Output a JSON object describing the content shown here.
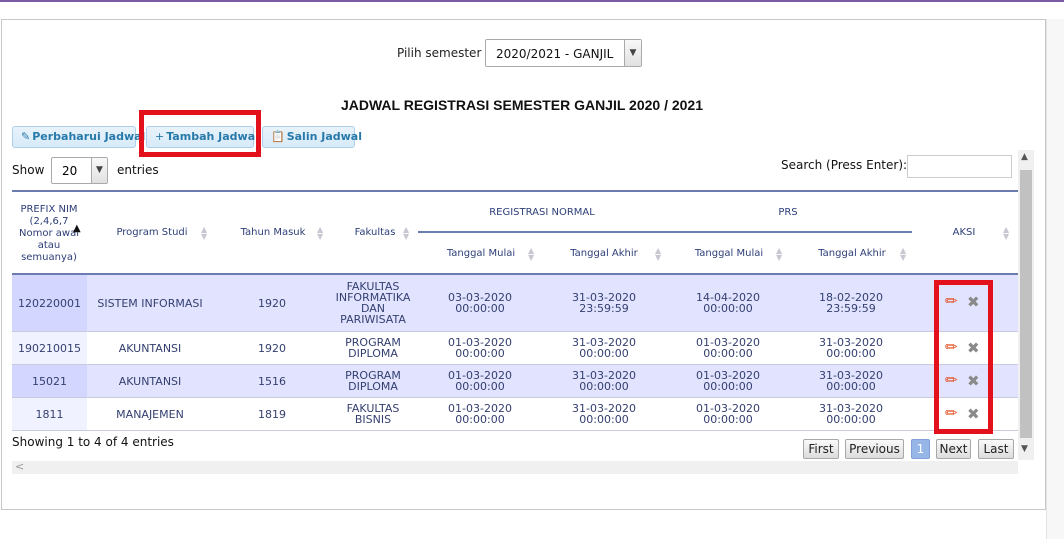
{
  "semester": {
    "label": "Pilih semester",
    "selected": "2020/2021 - GANJIL"
  },
  "title": "JADWAL REGISTRASI SEMESTER GANJIL 2020 / 2021",
  "toolbar": {
    "update": {
      "icon": "pencil-icon",
      "label": "Perbaharui Jadwal"
    },
    "add": {
      "icon": "plus-icon",
      "label": "Tambah Jadwal"
    },
    "copy": {
      "icon": "clipboard-icon",
      "label": "Salin Jadwal"
    }
  },
  "length": {
    "show": "Show",
    "value": "20",
    "entries": "entries"
  },
  "search": {
    "label": "Search (Press Enter):",
    "value": ""
  },
  "table": {
    "headers": {
      "prefix": "PREFIX NIM (2,4,6,7 Nomor awal atau semuanya)",
      "program": "Program Studi",
      "tahun": "Tahun Masuk",
      "fakultas": "Fakultas",
      "reg_normal": "REGISTRASI NORMAL",
      "prs": "PRS",
      "tgl_mulai": "Tanggal Mulai",
      "tgl_akhir": "Tanggal Akhir",
      "aksi": "AKSI"
    },
    "rows": [
      {
        "prefix": "120220001",
        "program": "SISTEM INFORMASI",
        "tahun": "1920",
        "fakultas": "FAKULTAS INFORMATIKA DAN PARIWISATA",
        "rn_mulai": "03-03-2020 00:00:00",
        "rn_akhir": "31-03-2020 23:59:59",
        "prs_mulai": "14-04-2020 00:00:00",
        "prs_akhir": "18-02-2020 23:59:59"
      },
      {
        "prefix": "190210015",
        "program": "AKUNTANSI",
        "tahun": "1920",
        "fakultas": "PROGRAM DIPLOMA",
        "rn_mulai": "01-03-2020 00:00:00",
        "rn_akhir": "31-03-2020 00:00:00",
        "prs_mulai": "01-03-2020 00:00:00",
        "prs_akhir": "31-03-2020 00:00:00"
      },
      {
        "prefix": "15021",
        "program": "AKUNTANSI",
        "tahun": "1516",
        "fakultas": "PROGRAM DIPLOMA",
        "rn_mulai": "01-03-2020 00:00:00",
        "rn_akhir": "31-03-2020 00:00:00",
        "prs_mulai": "01-03-2020 00:00:00",
        "prs_akhir": "31-03-2020 00:00:00"
      },
      {
        "prefix": "1811",
        "program": "MANAJEMEN",
        "tahun": "1819",
        "fakultas": "FAKULTAS BISNIS",
        "rn_mulai": "01-03-2020 00:00:00",
        "rn_akhir": "31-03-2020 00:00:00",
        "prs_mulai": "01-03-2020 00:00:00",
        "prs_akhir": "31-03-2020 00:00:00"
      }
    ]
  },
  "info": "Showing 1 to 4 of 4 entries",
  "pagination": {
    "first": "First",
    "previous": "Previous",
    "current": "1",
    "next": "Next",
    "last": "Last"
  },
  "colors": {
    "highlight": "#e3111c",
    "header_text": "#2d3e78",
    "row_odd": "#e2e4ff",
    "button_text": "#2779aa",
    "current_page": "#97b6e8"
  }
}
